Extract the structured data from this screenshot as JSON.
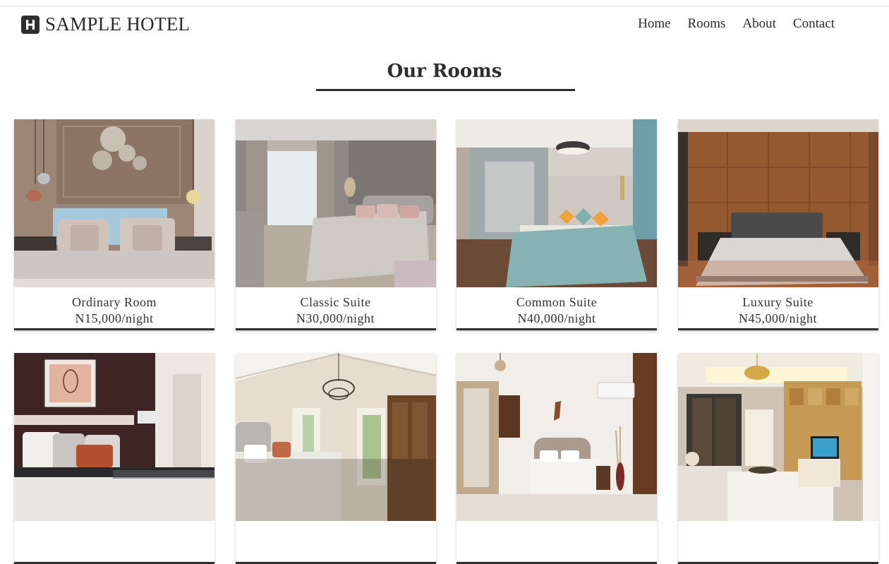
{
  "brand": {
    "logo_letter": "H",
    "name": "SAMPLE HOTEL",
    "icon": "hotel-logo-icon"
  },
  "nav": {
    "items": [
      {
        "label": "Home"
      },
      {
        "label": "Rooms"
      },
      {
        "label": "About"
      },
      {
        "label": "Contact"
      }
    ]
  },
  "section": {
    "title": "Our Rooms"
  },
  "rooms": [
    {
      "name": "Ordinary Room",
      "price": "N15,000/night"
    },
    {
      "name": "Classic Suite",
      "price": "N30,000/night"
    },
    {
      "name": "Common Suite",
      "price": "N40,000/night"
    },
    {
      "name": "Luxury Suite",
      "price": "N45,000/night"
    },
    {
      "name": "",
      "price": ""
    },
    {
      "name": "",
      "price": ""
    },
    {
      "name": "",
      "price": ""
    },
    {
      "name": "",
      "price": ""
    }
  ],
  "colors": {
    "text": "#2a2a2a",
    "accent_rule": "#2e2e2e",
    "background": "#ffffff"
  }
}
